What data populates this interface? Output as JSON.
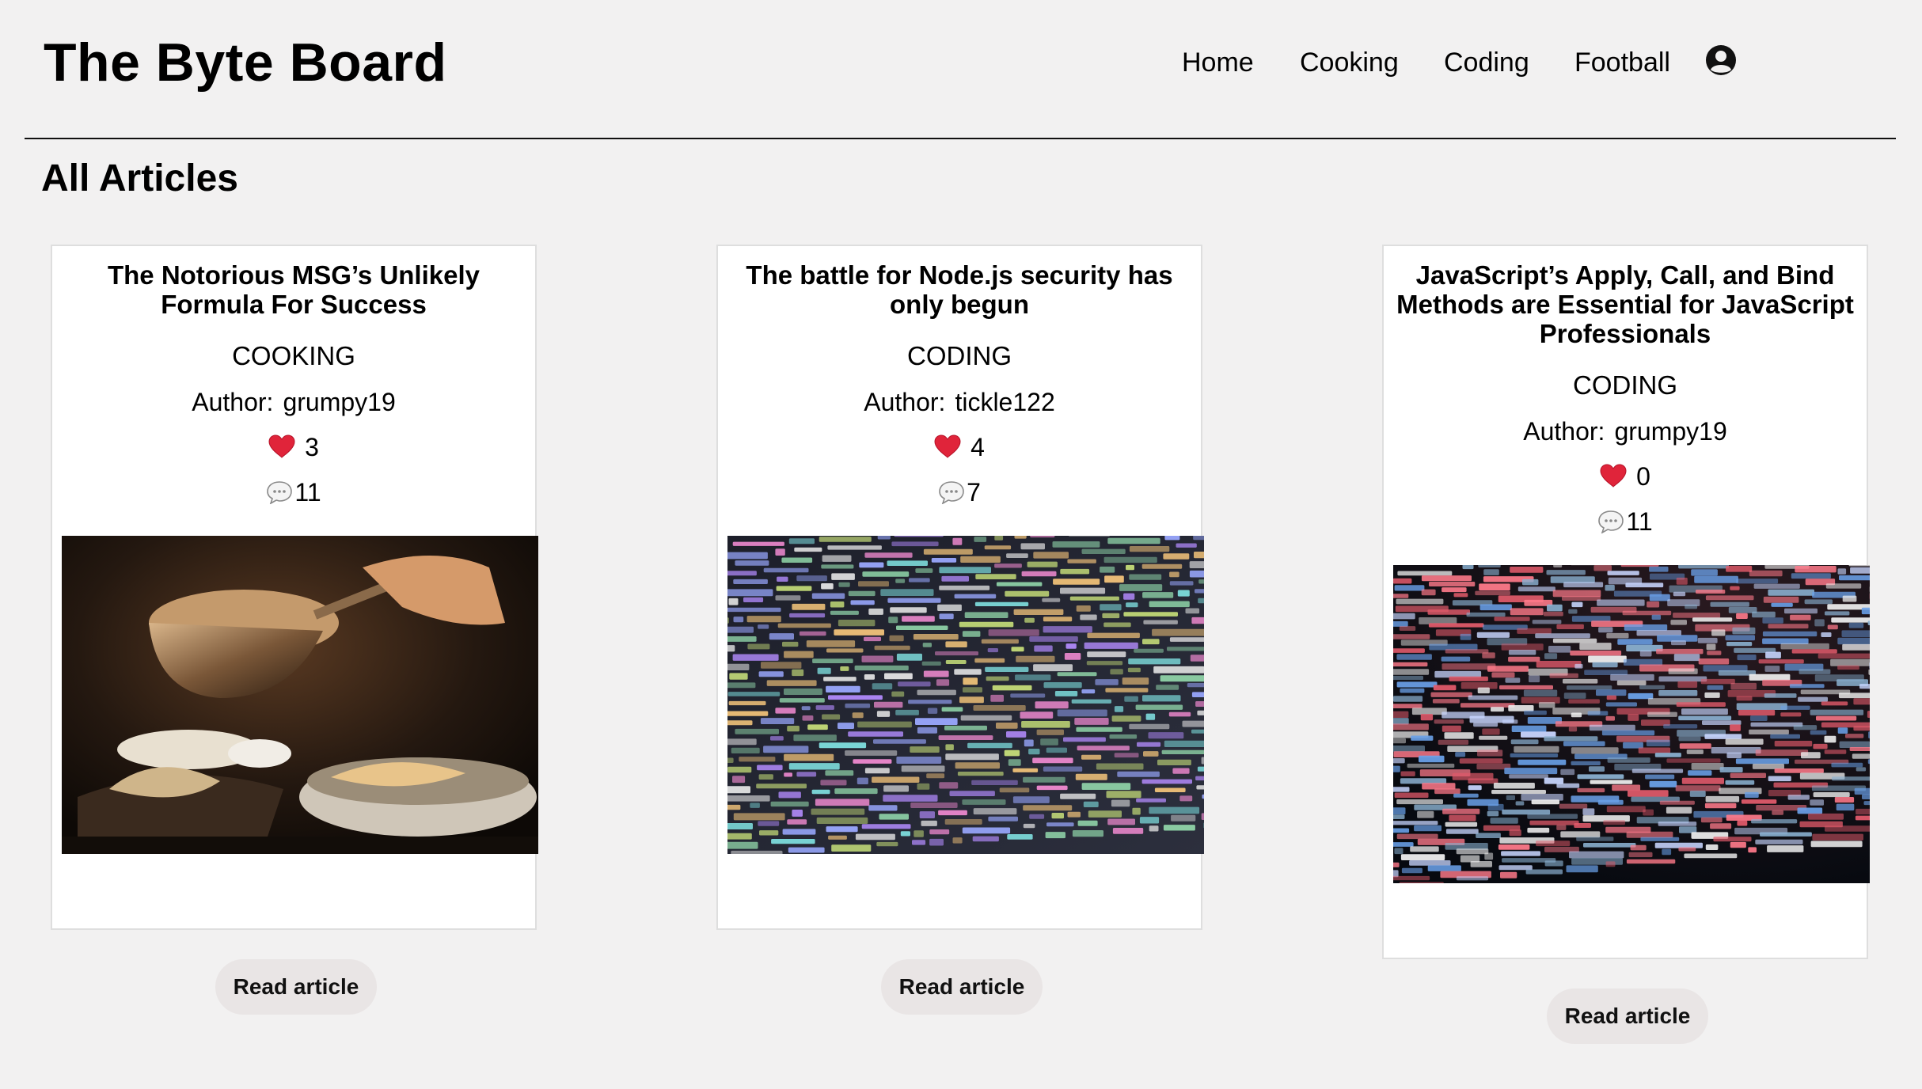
{
  "header": {
    "site_title": "The Byte Board",
    "nav": [
      {
        "label": "Home"
      },
      {
        "label": "Cooking"
      },
      {
        "label": "Coding"
      },
      {
        "label": "Football"
      }
    ],
    "account_icon": "user-circle-icon"
  },
  "main": {
    "section_title": "All Articles",
    "articles": [
      {
        "title": "The Notorious MSG’s Unlikely Formula For Success",
        "topic": "COOKING",
        "author_label": "Author:",
        "author": "grumpy19",
        "likes": "3",
        "comments": "11",
        "image": "cooking-pan-photo",
        "button_label": "Read article"
      },
      {
        "title": "The battle for Node.js security has only begun",
        "topic": "CODING",
        "author_label": "Author:",
        "author": "tickle122",
        "likes": "4",
        "comments": "7",
        "image": "colorful-code-screen-photo",
        "button_label": "Read article"
      },
      {
        "title": "JavaScript’s Apply, Call, and Bind Methods are Essential for JavaScript Professionals",
        "topic": "CODING",
        "author_label": "Author:",
        "author": "grumpy19",
        "likes": "0",
        "comments": "11",
        "image": "dark-code-screen-photo",
        "button_label": "Read article"
      }
    ]
  },
  "colors": {
    "background": "#f2f1f1",
    "card": "#ffffff",
    "button": "#e9e5e5",
    "heart": "#e0243a"
  }
}
